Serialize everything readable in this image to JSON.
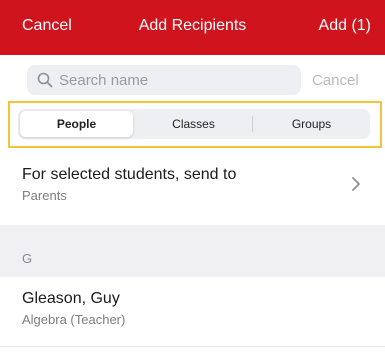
{
  "navbar": {
    "cancel_label": "Cancel",
    "title": "Add Recipients",
    "add_label": "Add (1)",
    "background_color": "#d0141e"
  },
  "search": {
    "placeholder": "Search name",
    "value": "",
    "icon": "search-icon",
    "cancel_label": "Cancel"
  },
  "segments": {
    "items": [
      {
        "label": "People",
        "selected": true
      },
      {
        "label": "Classes",
        "selected": false
      },
      {
        "label": "Groups",
        "selected": false
      }
    ],
    "highlight_color": "#f2c43a"
  },
  "send_to": {
    "title": "For selected students, send to",
    "value": "Parents",
    "icon": "chevron-right-icon"
  },
  "section": {
    "header": "G",
    "items": [
      {
        "name": "Gleason, Guy",
        "detail": "Algebra (Teacher)"
      }
    ]
  }
}
